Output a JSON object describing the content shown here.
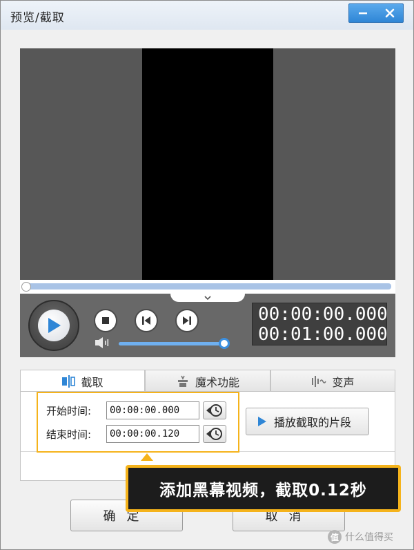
{
  "window": {
    "title": "预览/截取",
    "minimize_icon": "minimize-icon",
    "close_icon": "close-icon"
  },
  "player": {
    "progress": 0.0,
    "volume": 0.95,
    "current_time": "00:00:00.000",
    "total_time": "00:01:00.000"
  },
  "tabs": [
    {
      "label": "截取",
      "icon": "clip-icon",
      "active": true
    },
    {
      "label": "魔术功能",
      "icon": "magic-icon",
      "active": false
    },
    {
      "label": "变声",
      "icon": "voice-wave-icon",
      "active": false
    }
  ],
  "clip": {
    "start_label": "开始时间:",
    "start_value": "00:00:00.000",
    "end_label": "结束时间:",
    "end_value": "00:00:00.120",
    "play_segment_label": "播放截取的片段"
  },
  "buttons": {
    "ok_label": "确定",
    "cancel_label": "取消"
  },
  "callout": {
    "text": "添加黑幕视频，截取0.12秒"
  },
  "watermark": {
    "logo": "值",
    "text": "什么值得买"
  },
  "colors": {
    "accent_blue": "#3b8fe0",
    "highlight_yellow": "#f5b31b",
    "video_gray": "#575757",
    "control_bar": "#686868"
  }
}
